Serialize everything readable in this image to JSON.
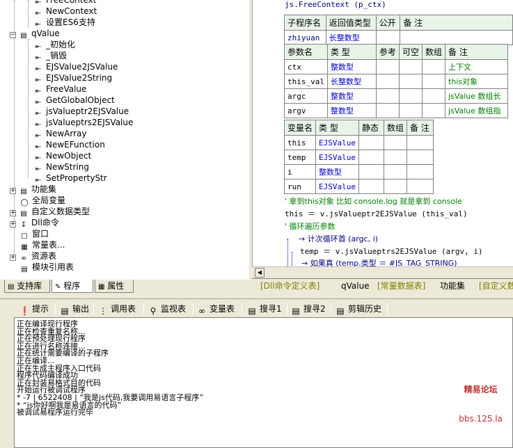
{
  "tree": {
    "items": [
      {
        "label": "FreeContext",
        "icon": "method-icon"
      },
      {
        "label": "NewContext",
        "icon": "method-icon"
      },
      {
        "label": "设置ES6支持",
        "icon": "method-icon"
      },
      {
        "label": "qValue",
        "icon": "module-icon",
        "expander": "−"
      },
      {
        "label": "_初始化",
        "icon": "method-icon"
      },
      {
        "label": "_销毁",
        "icon": "method-icon"
      },
      {
        "label": "EJSValue2JSValue",
        "icon": "method-icon"
      },
      {
        "label": "EJSValue2String",
        "icon": "method-icon"
      },
      {
        "label": "FreeValue",
        "icon": "method-icon"
      },
      {
        "label": "GetGlobalObject",
        "icon": "method-icon"
      },
      {
        "label": "jsValueptr2EJSValue",
        "icon": "method-icon"
      },
      {
        "label": "jsValueptrs2EJSValue",
        "icon": "method-icon"
      },
      {
        "label": "NewArray",
        "icon": "method-icon"
      },
      {
        "label": "NewEFunction",
        "icon": "method-icon"
      },
      {
        "label": "NewObject",
        "icon": "method-icon"
      },
      {
        "label": "NewString",
        "icon": "method-icon"
      },
      {
        "label": "SetPropertyStr",
        "icon": "method-icon"
      },
      {
        "label": "功能集",
        "icon": "books-icon",
        "expander": "+"
      },
      {
        "label": "全局变量",
        "icon": "cylinder-icon"
      },
      {
        "label": "自定义数据类型",
        "icon": "datatype-icon",
        "expander": "+"
      },
      {
        "label": "Dll命令",
        "icon": "dll-icon",
        "expander": "+"
      },
      {
        "label": "窗口",
        "icon": "window-icon"
      },
      {
        "label": "常量表...",
        "icon": "constant-icon"
      },
      {
        "label": "资源表",
        "icon": "resource-icon",
        "expander": "+"
      },
      {
        "label": "模块引用表",
        "icon": "module-ref-icon"
      }
    ]
  },
  "left_tabs": [
    {
      "label": "支持库"
    },
    {
      "label": "程序"
    },
    {
      "label": "属性"
    }
  ],
  "code": {
    "header_line": "js.FreeContext (p_ctx)",
    "sub_table": {
      "headers": [
        "子程序名",
        "返回值类型",
        "公开",
        "备 注"
      ],
      "row": [
        "zhiyuan",
        "长整数型",
        "",
        ""
      ]
    },
    "param_table": {
      "headers": [
        "参数名",
        "类 型",
        "参考",
        "可空",
        "数组",
        "备 注"
      ],
      "rows": [
        [
          "ctx",
          "整数型",
          "",
          "",
          "",
          "上下文"
        ],
        [
          "this_val",
          "长整数型",
          "",
          "",
          "",
          "this对象"
        ],
        [
          "argc",
          "整数型",
          "",
          "",
          "",
          "jsValue 数组长"
        ],
        [
          "argv",
          "整数型",
          "",
          "",
          "",
          "jsValue 数组指"
        ]
      ]
    },
    "var_table": {
      "headers": [
        "变量名",
        "类 型",
        "静态",
        "数组",
        "备 注"
      ],
      "rows": [
        [
          "this",
          "EJSValue",
          "",
          "",
          ""
        ],
        [
          "temp",
          "EJSValue",
          "",
          "",
          ""
        ],
        [
          "i",
          "整数型",
          "",
          "",
          ""
        ],
        [
          "run",
          "EJSValue",
          "",
          "",
          ""
        ]
      ]
    },
    "lines": [
      "' 拿到this对象  比如 console.log 就是拿到 console",
      "this ＝ v.jsValueptr2EJSValue (this_val)",
      "' 循环遍历参数",
      "计次循环首 (argc, i)",
      "temp ＝ v.jsValueptrs2EJSValue (argv, i)",
      "如果真 (temp.类型 ＝ #JS_TAG_STRING)"
    ]
  },
  "code_tabs": [
    {
      "label": "[Dll命令定义表]"
    },
    {
      "label": "qValue"
    },
    {
      "label": "[常量数据表]"
    },
    {
      "label": "功能集"
    },
    {
      "label": "[自定义数"
    }
  ],
  "output_tabs": [
    {
      "label": "提示",
      "icon": "hint-icon"
    },
    {
      "label": "输出",
      "icon": "output-icon"
    },
    {
      "label": "调用表",
      "icon": "calltable-icon"
    },
    {
      "label": "监视表",
      "icon": "watch-icon"
    },
    {
      "label": "变量表",
      "icon": "variable-icon"
    },
    {
      "label": "搜寻1",
      "icon": "search-icon"
    },
    {
      "label": "搜寻2",
      "icon": "search-icon"
    },
    {
      "label": "剪辑历史",
      "icon": "clipboard-icon"
    }
  ],
  "output": {
    "lines": [
      "正在编译现行程序",
      "正在检查重复名称...",
      "正在预处理现行程序",
      "正在进行名称连接...",
      "正在统计需要编译的子程序",
      "正在编译...",
      "正在生成主程序入口代码",
      "程序代码编译成功",
      "正在封装易格式目的代码",
      "开始运行被调试程序",
      "* -7 | 6522408 | “我是js代码,我要调用易语言子程序”",
      "* “js你好啊我是易语言的代码”",
      "被调试易程序运行完毕"
    ]
  },
  "watermark": {
    "line1": "精易论坛",
    "line2": "bbs.125.la"
  },
  "colors": {
    "type_blue": "#0000cc",
    "comment_green": "#008000",
    "header_bg": "#e8f4e8"
  }
}
